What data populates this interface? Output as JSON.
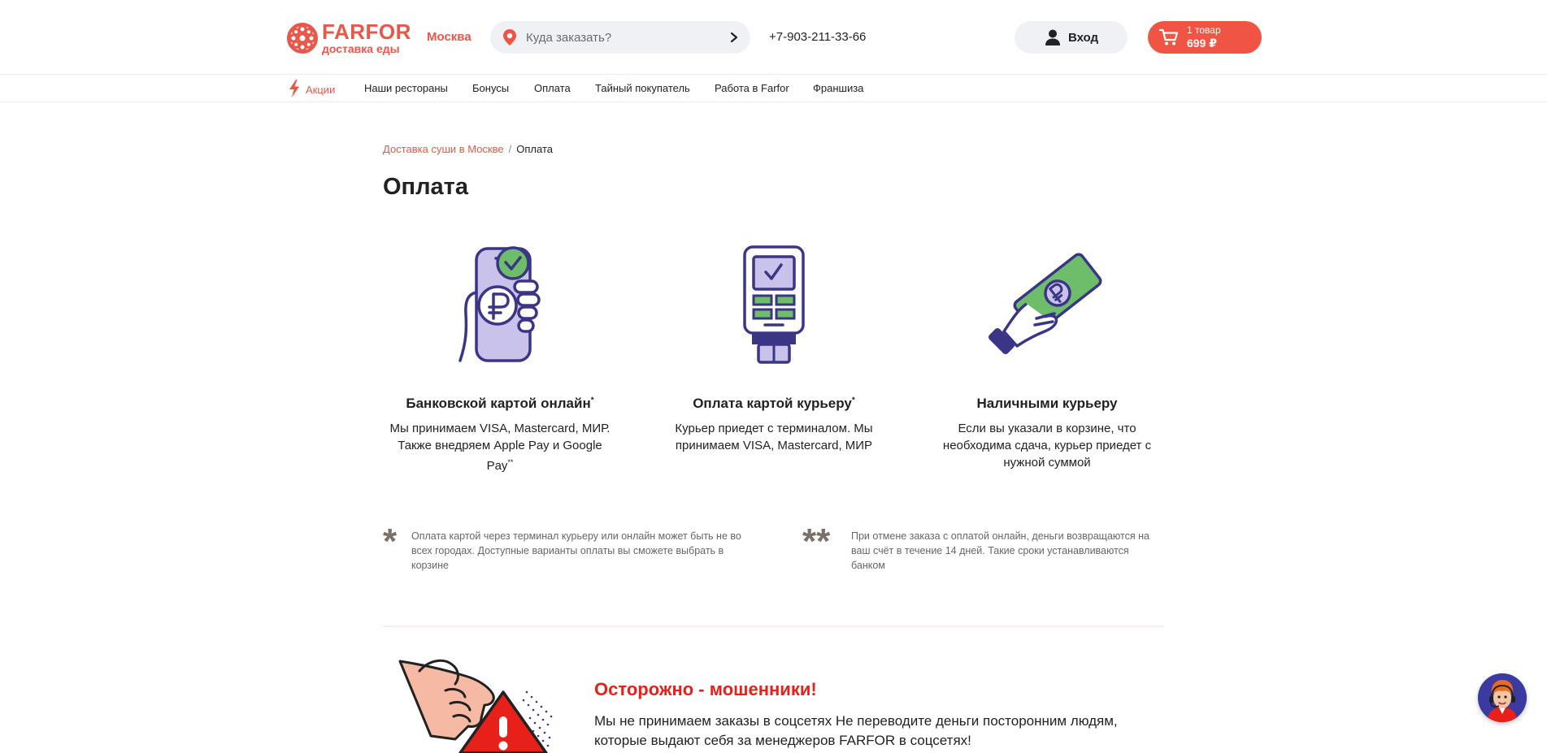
{
  "header": {
    "logo_brand": "FARFOR",
    "logo_sub": "доставка еды",
    "city": "Москва",
    "search_placeholder": "Куда заказать?",
    "phone": "+7-903-211-33-66",
    "login_label": "Вход",
    "cart_count": "1 товар",
    "cart_sum": "699 ₽"
  },
  "nav": {
    "items": [
      "Акции",
      "Наши рестораны",
      "Бонусы",
      "Оплата",
      "Тайный покупатель",
      "Работа в Farfor",
      "Франшиза"
    ]
  },
  "breadcrumb": {
    "link": "Доставка суши в Москве",
    "separator": "/",
    "current": "Оплата"
  },
  "page_title": "Оплата",
  "methods": [
    {
      "title": "Банковской картой онлайн",
      "title_mark": "*",
      "text": "Мы принимаем VISA, Mastercard, МИР. Также внедряем Apple Pay и Google Pay",
      "text_mark": "**",
      "icon": "phone-payment-icon"
    },
    {
      "title": "Оплата картой курьеру",
      "title_mark": "*",
      "text": "Курьер приедет с терминалом. Мы принимаем VISA, Mastercard, МИР",
      "icon": "card-terminal-icon"
    },
    {
      "title": "Наличными курьеру",
      "text": "Если вы указали в корзине, что необходима сдача, курьер приедет с нужной суммой",
      "icon": "cash-hand-icon"
    }
  ],
  "notes": [
    {
      "mark": "*",
      "text": "Оплата картой через терминал курьеру или онлайн может быть не во всех городах. Доступные варианты оплаты вы сможете выбрать в корзине"
    },
    {
      "mark": "**",
      "text": "При отмене заказа с оплатой онлайн, деньги возвращаются на ваш счёт в течение 14 дней. Такие сроки устанавливаются банком"
    }
  ],
  "warning": {
    "title": "Осторожно - мошенники!",
    "text": "Мы не принимаем заказы в соцсетях Не переводите деньги посторонним людям, которые выдают себя за менеджеров FARFOR в соцсетях!"
  },
  "colors": {
    "brand": "#e8574a",
    "cart": "#f05444",
    "warning": "#e8201a",
    "illustration_purple": "#c9c3ec",
    "illustration_green": "#6dbd6a",
    "illustration_stroke": "#3b3585"
  }
}
